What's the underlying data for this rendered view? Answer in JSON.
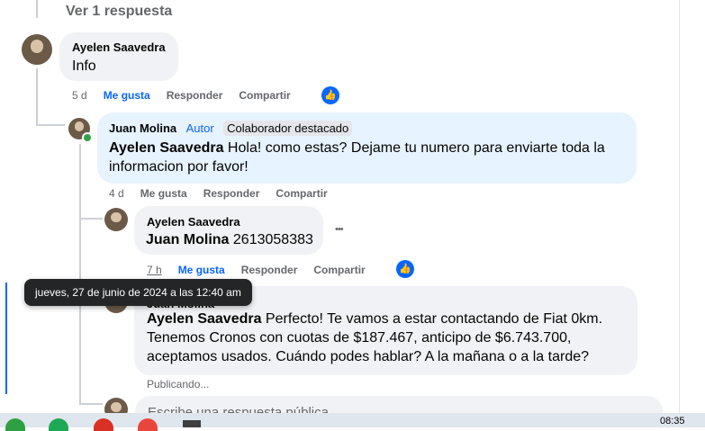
{
  "view_replies": "Ver 1 respuesta",
  "comments": [
    {
      "author": "Ayelen Saavedra",
      "text": "Info",
      "time": "5 d",
      "like": "Me gusta",
      "reply": "Responder",
      "share": "Compartir"
    },
    {
      "author": "Juan Molina",
      "author_label": "Autor",
      "badge": "Colaborador destacado",
      "mention": "Ayelen Saavedra",
      "text": " Hola! como estas? Dejame tu numero para enviarte toda la informacion por favor!",
      "time": "4 d",
      "like": "Me gusta",
      "reply": "Responder",
      "share": "Compartir"
    },
    {
      "author": "Ayelen Saavedra",
      "mention": "Juan Molina",
      "text": " 2613058383",
      "more": "•••",
      "time": "7 h",
      "like": "Me gusta",
      "reply": "Responder",
      "share": "Compartir"
    },
    {
      "author": "Juan Molina",
      "mention": "Ayelen Saavedra",
      "text": " Perfecto! Te vamos a estar contactando de Fiat 0km. Tenemos Cronos con cuotas de $187.467, anticipo de $6.743.700, aceptamos usados. Cuándo podes hablar? A la mañana o a la tarde?",
      "status": "Publicando..."
    }
  ],
  "tooltip": "jueves, 27 de junio de 2024 a las 12:40 am",
  "reply_placeholder": "Escribe una respuesta pública...",
  "taskbar": {
    "clock": "08:35"
  },
  "colors": {
    "accent": "#0866ff",
    "bubble": "#f0f2f5",
    "author_bubble": "#e7f3ff"
  }
}
